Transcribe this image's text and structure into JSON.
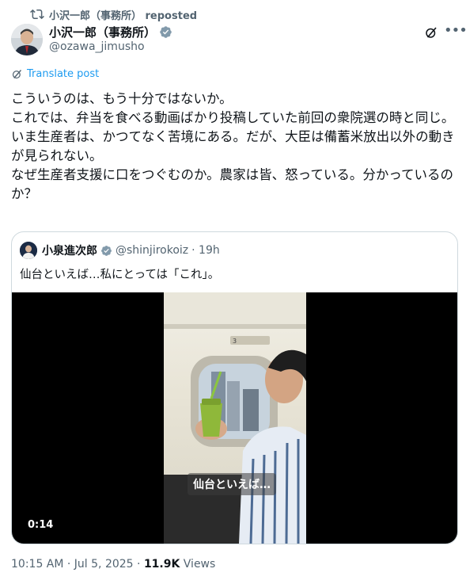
{
  "repost": {
    "icon": "repost-icon",
    "label": "小沢一郎（事務所） reposted"
  },
  "author": {
    "name": "小沢一郎（事務所）",
    "handle": "@ozawa_jimusho",
    "verified_color": "#829aab"
  },
  "translate": {
    "label": "Translate post"
  },
  "post": {
    "text": "こういうのは、もう十分ではないか。\nこれでは、弁当を食べる動画ばかり投稿していた前回の衆院選の時と同じ。\nいま生産者は、かつてなく苦境にある。だが、大臣は備蓄米放出以外の動きが見られない。\nなぜ生産者支援に口をつぐむのか。農家は皆、怒っている。分かっているのか？"
  },
  "quoted": {
    "name": "小泉進次郎",
    "handle": "@shinjirokoiz",
    "time": "· 19h",
    "text": "仙台といえば…私にとっては「これ」。",
    "video": {
      "caption": "仙台といえば…",
      "duration": "0:14",
      "car_number": "3"
    }
  },
  "meta": {
    "timestamp": "10:15 AM · Jul 5, 2025 · ",
    "views_count": "11.9K",
    "views_label": " Views"
  },
  "colors": {
    "accent": "#1d9bf0",
    "muted": "#536471",
    "border": "#cfd9de"
  }
}
